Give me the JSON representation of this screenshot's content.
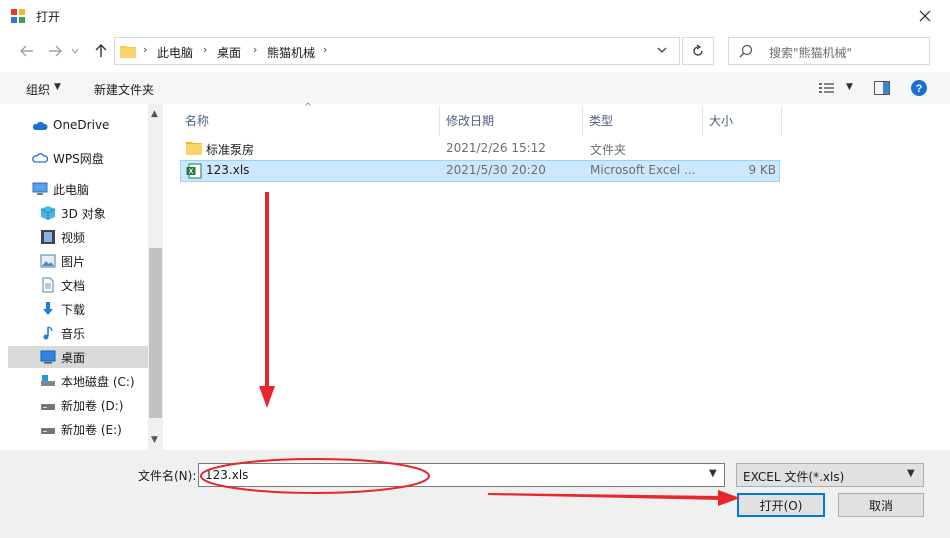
{
  "window": {
    "title": "打开"
  },
  "address": {
    "crumbs": [
      "此电脑",
      "桌面",
      "熊猫机械"
    ]
  },
  "search": {
    "placeholder": "搜索\"熊猫机械\""
  },
  "toolbar": {
    "organize": "组织",
    "new_folder": "新建文件夹"
  },
  "nav": {
    "items": [
      {
        "label": "OneDrive",
        "icon": "cloud-icon"
      },
      {
        "label": "WPS网盘",
        "icon": "cloud-outline-icon"
      },
      {
        "label": "此电脑",
        "icon": "computer-icon"
      },
      {
        "label": "3D 对象",
        "icon": "cube-icon"
      },
      {
        "label": "视频",
        "icon": "film-icon"
      },
      {
        "label": "图片",
        "icon": "picture-icon"
      },
      {
        "label": "文档",
        "icon": "document-icon"
      },
      {
        "label": "下载",
        "icon": "download-icon"
      },
      {
        "label": "音乐",
        "icon": "music-icon"
      },
      {
        "label": "桌面",
        "icon": "desktop-icon"
      },
      {
        "label": "本地磁盘 (C:)",
        "icon": "drive-c-icon"
      },
      {
        "label": "新加卷 (D:)",
        "icon": "drive-icon"
      },
      {
        "label": "新加卷 (E:)",
        "icon": "drive-icon"
      }
    ]
  },
  "columns": {
    "name": "名称",
    "date": "修改日期",
    "type": "类型",
    "size": "大小"
  },
  "files": [
    {
      "name": "标准泵房",
      "date": "2021/2/26 15:12",
      "type": "文件夹",
      "size": ""
    },
    {
      "name": "123.xls",
      "date": "2021/5/30 20:20",
      "type": "Microsoft Excel ...",
      "size": "9 KB"
    }
  ],
  "bottom": {
    "filename_label": "文件名(N):",
    "filename_value": "123.xls",
    "filter_value": "EXCEL 文件(*.xls)",
    "open_label": "打开(O)",
    "cancel_label": "取消"
  },
  "colors": {
    "annotation": "#e8262b",
    "selection": "#cce8ff",
    "accent": "#0078d7"
  }
}
